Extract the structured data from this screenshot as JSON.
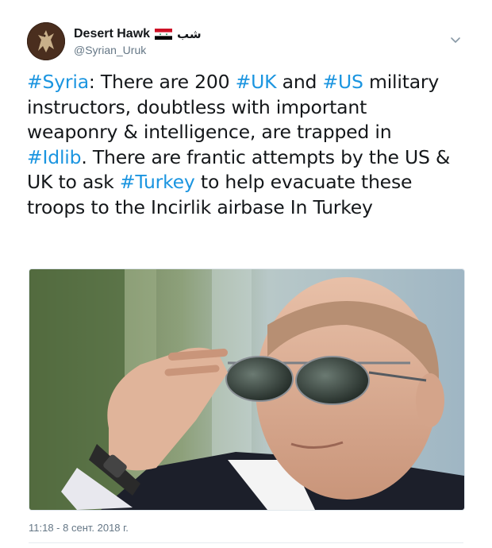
{
  "author": {
    "display_name": "Desert Hawk",
    "arabic_name": "شب",
    "handle": "@Syrian_Uruk",
    "flag_icon": "syria-flag-icon"
  },
  "tweet": {
    "lines": [
      [
        {
          "t": "#Syria",
          "tag": true
        },
        {
          "t": ": There are 200 "
        },
        {
          "t": "#UK",
          "tag": true
        },
        {
          "t": " and "
        },
        {
          "t": "#US",
          "tag": true
        },
        {
          "t": " military"
        }
      ],
      [
        {
          "t": "instructors, doubtless with important"
        }
      ],
      [
        {
          "t": "weaponry & intelligence, are trapped in"
        }
      ],
      [
        {
          "t": "#Idlib",
          "tag": true
        },
        {
          "t": ". There are frantic attempts by the US &"
        }
      ],
      [
        {
          "t": "UK to ask "
        },
        {
          "t": "#Turkey",
          "tag": true
        },
        {
          "t": " to help evacuate these"
        }
      ],
      [
        {
          "t": "troops to the Incirlik airbase In Turkey"
        }
      ]
    ],
    "timestamp": "11:18 - 8 сент. 2018 г."
  },
  "colors": {
    "link": "#1b95e0",
    "text": "#14171a",
    "muted": "#657786"
  }
}
